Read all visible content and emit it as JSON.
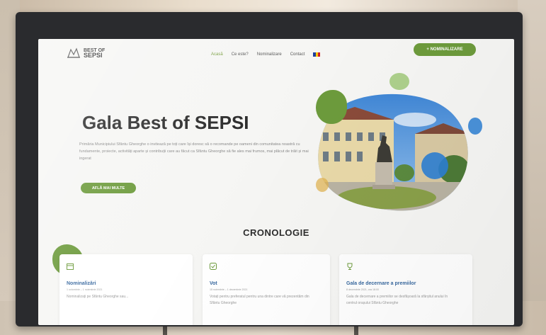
{
  "site": {
    "logo": {
      "line1": "BEST OF",
      "line2": "SEPSI"
    },
    "nav": [
      {
        "label": "Acasă"
      },
      {
        "label": "Ce este?"
      },
      {
        "label": "Nominalizare"
      },
      {
        "label": "Contact"
      }
    ],
    "language": "RO",
    "cta_label": "+ NOMINALIZARE"
  },
  "hero": {
    "title": "Gala Best of SEPSI",
    "text": "Primăria Municipiului Sfântu Gheorghe o invitează pe toți care își doresc să o recomande pe oameni din comunitatea noastră cu fundamente, proiecte, activități aparte și contribuții care au făcut ca Sfântu Gheorghe să fie ales mai frumos, mai plăcut de trăit și mai ingerat",
    "button_label": "AFLĂ MAI MULTE"
  },
  "timeline": {
    "title": "CRONOLOGIE",
    "cards": [
      {
        "title": "Nominalizări",
        "date": "1 octombrie – 1 noiembrie 2021",
        "text": "Nominalizați pe Sfântu Gheorghe sau..."
      },
      {
        "title": "Vot",
        "date": "15 noiembrie – 1 decembrie 2021",
        "text": "Votați pentru preferatul pentru una dintre care vă prezentăm din Sfântu Gheorghe"
      },
      {
        "title": "Gala de decernare a premiilor",
        "date": "8 decembrie 2021, ora 18:00",
        "text": "Gala de decernare a premiilor se desfășoară la sfârșitul anului în centrul orașului Sfântu Gheorghe"
      }
    ]
  },
  "colors": {
    "accent": "#6d9b3c",
    "title": "#2d2d2d",
    "card_title": "#3a6aa0",
    "flag": [
      "#1e3f9c",
      "#f5c400",
      "#cf1f2c"
    ]
  },
  "icons": [
    "logo-icon",
    "calendar-icon",
    "check-icon",
    "trophy-icon"
  ]
}
